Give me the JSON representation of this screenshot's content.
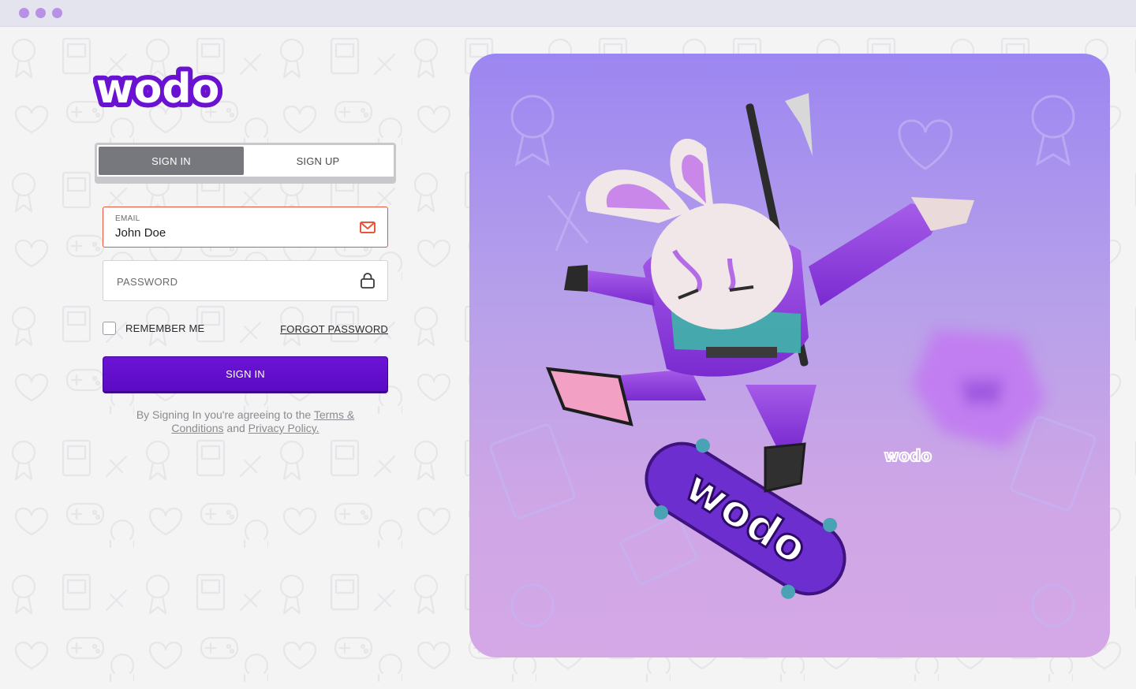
{
  "window": {
    "dots": 3
  },
  "brand": {
    "logo_text": "wodo",
    "hero_logo_text": "wodo",
    "skate_text": "wodo",
    "accent": "#6a12d2",
    "card_color": "#a18af0"
  },
  "auth_tabs": {
    "active": "SIGN IN",
    "inactive": "SIGN UP"
  },
  "email_field": {
    "label": "EMAIL",
    "value": "John Doe",
    "border_color": "#e8553a",
    "icon": "mail-icon"
  },
  "password_field": {
    "placeholder": "PASSWORD",
    "icon": "lock-icon"
  },
  "remember": {
    "label": "REMEMBER ME",
    "checked": false
  },
  "forgot": {
    "label": "FORGOT PASSWORD"
  },
  "submit": {
    "label": "SIGN IN"
  },
  "terms": {
    "prefix": "By Signing In you're agreeing to the ",
    "terms_link": "Terms & Conditions",
    "middle": " and ",
    "privacy_link": "Privacy Policy."
  }
}
